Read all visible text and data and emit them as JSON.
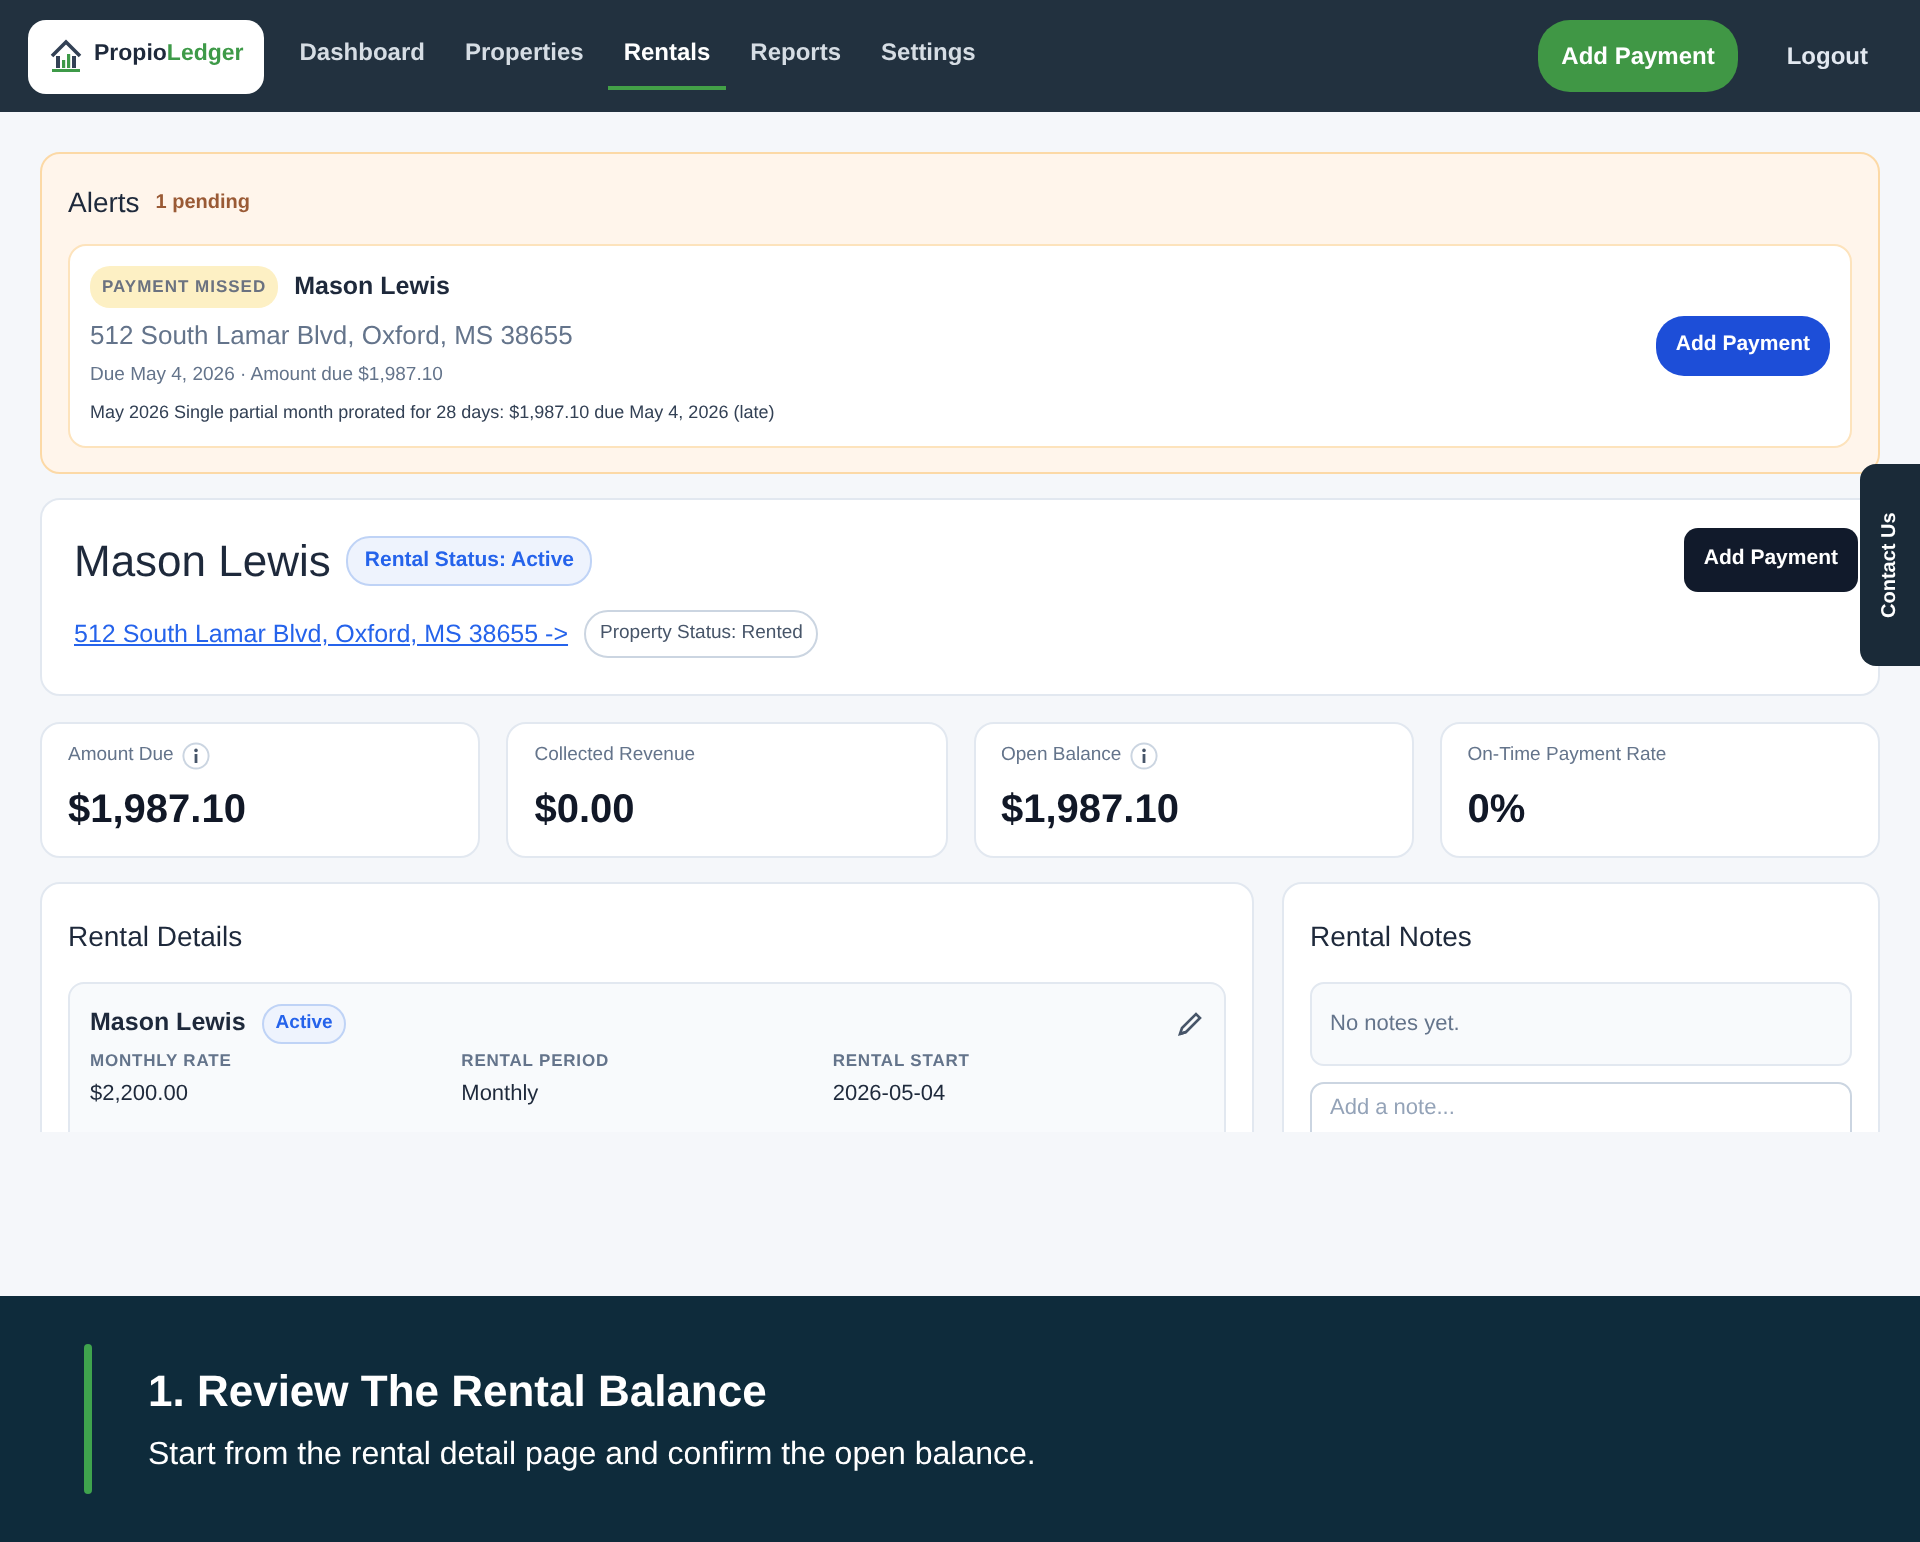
{
  "nav": {
    "brand": {
      "first": "Propio",
      "second": "Ledger"
    },
    "links": [
      {
        "label": "Dashboard",
        "selected": false
      },
      {
        "label": "Properties",
        "selected": false
      },
      {
        "label": "Rentals",
        "selected": true
      },
      {
        "label": "Reports",
        "selected": false
      },
      {
        "label": "Settings",
        "selected": false
      }
    ],
    "action": "Add Payment",
    "logout": "Logout"
  },
  "alerts": {
    "title": "Alerts",
    "count": "1 pending",
    "items": [
      {
        "badge": "PAYMENT MISSED",
        "name": "Mason Lewis",
        "address": "512 South Lamar Blvd, Oxford, MS 38655",
        "due": "Due May 4, 2026 · Amount due $1,987.10",
        "note": "May 2026 Single partial month prorated for 28 days: $1,987.10 due May 4, 2026 (late)",
        "button": "Add Payment"
      }
    ]
  },
  "header": {
    "name": "Mason Lewis",
    "status": "Rental Status: Active",
    "address_link": "512 South Lamar Blvd, Oxford, MS 38655 ->",
    "property_status": "Property Status: Rented",
    "button": "Add Payment"
  },
  "stats": [
    {
      "label": "Amount Due",
      "info": true,
      "value": "$1,987.10"
    },
    {
      "label": "Collected Revenue",
      "info": false,
      "value": "$0.00"
    },
    {
      "label": "Open Balance",
      "info": true,
      "value": "$1,987.10"
    },
    {
      "label": "On-Time Payment Rate",
      "info": false,
      "value": "0%"
    }
  ],
  "details": {
    "title": "Rental Details",
    "rental": {
      "name": "Mason Lewis",
      "status": "Active",
      "fields": [
        {
          "label": "MONTHLY RATE",
          "value": "$2,200.00"
        },
        {
          "label": "RENTAL PERIOD",
          "value": "Monthly"
        },
        {
          "label": "RENTAL START",
          "value": "2026-05-04"
        }
      ]
    }
  },
  "notes": {
    "title": "Rental Notes",
    "empty": "No notes yet.",
    "placeholder": "Add a note..."
  },
  "contact_tab": "Contact Us",
  "banner": {
    "title": "1. Review The Rental Balance",
    "subtitle": "Start from the rental detail page and confirm the open balance."
  }
}
